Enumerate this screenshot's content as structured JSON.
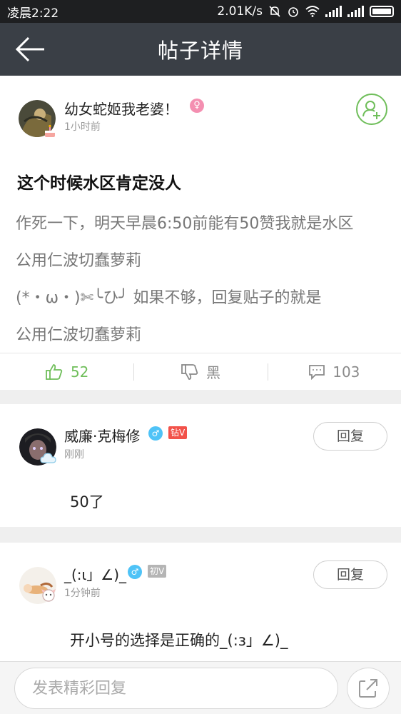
{
  "status_bar": {
    "time": "凌晨2:22",
    "speed": "2.01K/s"
  },
  "header": {
    "title": "帖子详情"
  },
  "post": {
    "author": "幼女蛇姬我老婆！",
    "time": "1小时前",
    "title": "这个时候水区肯定没人",
    "lines": [
      "作死一下，明天早晨6:50前能有50赞我就是水区",
      "公用仁波切蠢萝莉",
      "(*・ω・)✄╰ひ╯ 如果不够，回复贴子的就是",
      "公用仁波切蠢萝莉"
    ],
    "likes": "52",
    "dislike_label": "黑",
    "comments": "103"
  },
  "comments": [
    {
      "author": "威廉·克梅修",
      "badge": "钻V",
      "time": "刚刚",
      "text": "50了",
      "reply_label": "回复"
    },
    {
      "author": "_(:ι」∠)_",
      "badge": "初V",
      "time": "1分钟前",
      "text": "开小号的选择是正确的_(:з」∠)_",
      "reply_label": "回复"
    }
  ],
  "bottom": {
    "placeholder": "发表精彩回复"
  },
  "colors": {
    "nav": "#3a3f46",
    "accent_green": "#6fbe5a",
    "female": "#f48fb1",
    "male": "#4fc3f7",
    "diamond_v": "#f2524a",
    "initial_v": "#b5b5b5"
  }
}
